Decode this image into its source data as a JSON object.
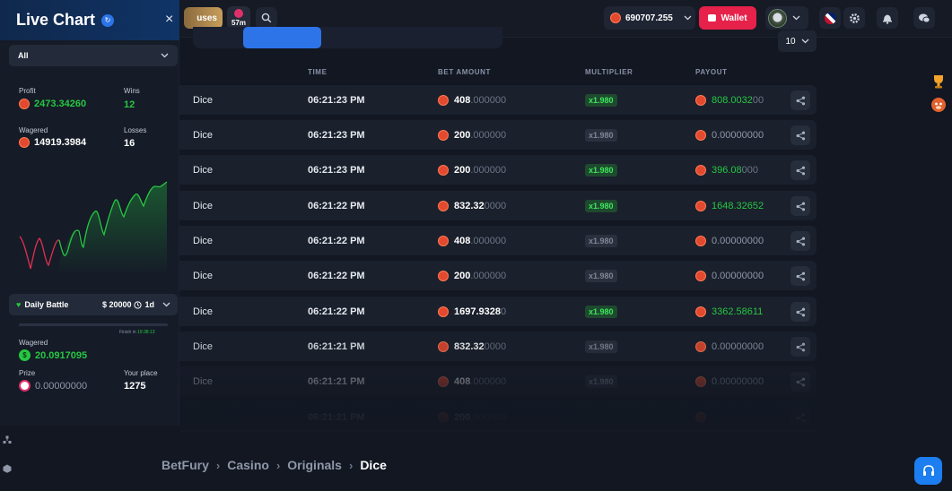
{
  "header": {
    "bonuses_label": "uses",
    "timer_label": "57m",
    "balance": "690707.255",
    "wallet_label": "Wallet"
  },
  "live_chart": {
    "title": "Live Chart",
    "close_label": "×",
    "filter_value": "All",
    "profit_label": "Profit",
    "profit_value": "2473.34260",
    "wins_label": "Wins",
    "wins_value": "12",
    "wagered_label": "Wagered",
    "wagered_value": "14919.3984",
    "losses_label": "Losses",
    "losses_value": "16"
  },
  "daily_battle": {
    "label": "Daily Battle",
    "amount": "$ 20000",
    "duration": "1d",
    "finish_label": "Finish in",
    "finish_time": "19:38:13",
    "wagered_label": "Wagered",
    "wagered_value": "20.0917095",
    "prize_label": "Prize",
    "prize_value": "0.00000000",
    "place_label": "Your place",
    "place_value": "1275"
  },
  "table": {
    "columns": {
      "time": "TIME",
      "bet": "BET AMOUNT",
      "multiplier": "MULTIPLIER",
      "payout": "PAYOUT"
    },
    "rows_per_page": "10",
    "rows": [
      {
        "game": "Dice",
        "time": "06:21:23 PM",
        "bet_main": "408",
        "bet_tail": ".000000",
        "mult": "x1.980",
        "win": true,
        "pay_main": "808.0032",
        "pay_tail": "00"
      },
      {
        "game": "Dice",
        "time": "06:21:23 PM",
        "bet_main": "200",
        "bet_tail": ".000000",
        "mult": "x1.980",
        "win": false,
        "pay_main": "0.00000000",
        "pay_tail": ""
      },
      {
        "game": "Dice",
        "time": "06:21:23 PM",
        "bet_main": "200",
        "bet_tail": ".000000",
        "mult": "x1.980",
        "win": true,
        "pay_main": "396.08",
        "pay_tail": "000"
      },
      {
        "game": "Dice",
        "time": "06:21:22 PM",
        "bet_main": "832.32",
        "bet_tail": "0000",
        "mult": "x1.980",
        "win": true,
        "pay_main": "1648.32652",
        "pay_tail": ""
      },
      {
        "game": "Dice",
        "time": "06:21:22 PM",
        "bet_main": "408",
        "bet_tail": ".000000",
        "mult": "x1.980",
        "win": false,
        "pay_main": "0.00000000",
        "pay_tail": ""
      },
      {
        "game": "Dice",
        "time": "06:21:22 PM",
        "bet_main": "200",
        "bet_tail": ".000000",
        "mult": "x1.980",
        "win": false,
        "pay_main": "0.00000000",
        "pay_tail": ""
      },
      {
        "game": "Dice",
        "time": "06:21:22 PM",
        "bet_main": "1697.9328",
        "bet_tail": "0",
        "mult": "x1.980",
        "win": true,
        "pay_main": "3362.58611",
        "pay_tail": ""
      },
      {
        "game": "Dice",
        "time": "06:21:21 PM",
        "bet_main": "832.32",
        "bet_tail": "0000",
        "mult": "x1.980",
        "win": false,
        "pay_main": "0.00000000",
        "pay_tail": ""
      },
      {
        "game": "Dice",
        "time": "06:21:21 PM",
        "bet_main": "408",
        "bet_tail": ".000000",
        "mult": "x1.980",
        "win": false,
        "pay_main": "0.00000000",
        "pay_tail": ""
      },
      {
        "game": "",
        "time": "06:21:21 PM",
        "bet_main": "200",
        "bet_tail": ".000000",
        "mult": "",
        "win": false,
        "pay_main": "",
        "pay_tail": ""
      }
    ]
  },
  "breadcrumb": [
    "BetFury",
    "Casino",
    "Originals",
    "Dice"
  ],
  "colors": {
    "accent": "#2d74e8",
    "win": "#26c742",
    "wallet": "#e6214a",
    "loss_line": "#e0314f"
  }
}
